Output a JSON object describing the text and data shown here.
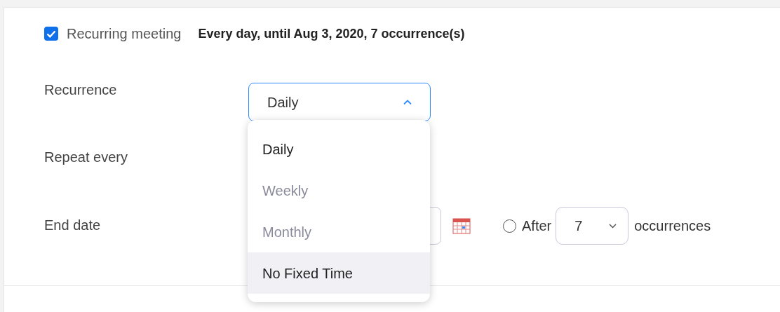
{
  "recurring": {
    "checked": true,
    "label": "Recurring meeting",
    "summary": "Every day, until Aug 3, 2020, 7 occurrence(s)"
  },
  "recurrence": {
    "label": "Recurrence",
    "value": "Daily",
    "expanded": true,
    "options": [
      {
        "label": "Daily",
        "selected": true,
        "disabled": false,
        "highlighted": false
      },
      {
        "label": "Weekly",
        "selected": false,
        "disabled": true,
        "highlighted": false
      },
      {
        "label": "Monthly",
        "selected": false,
        "disabled": true,
        "highlighted": false
      },
      {
        "label": "No Fixed Time",
        "selected": false,
        "disabled": false,
        "highlighted": true
      }
    ]
  },
  "repeat_every": {
    "label": "Repeat every"
  },
  "end_date": {
    "label": "End date",
    "after_selected": false,
    "after_label": "After",
    "occurrences_value": "7",
    "occurrences_label": "occurrences"
  }
}
